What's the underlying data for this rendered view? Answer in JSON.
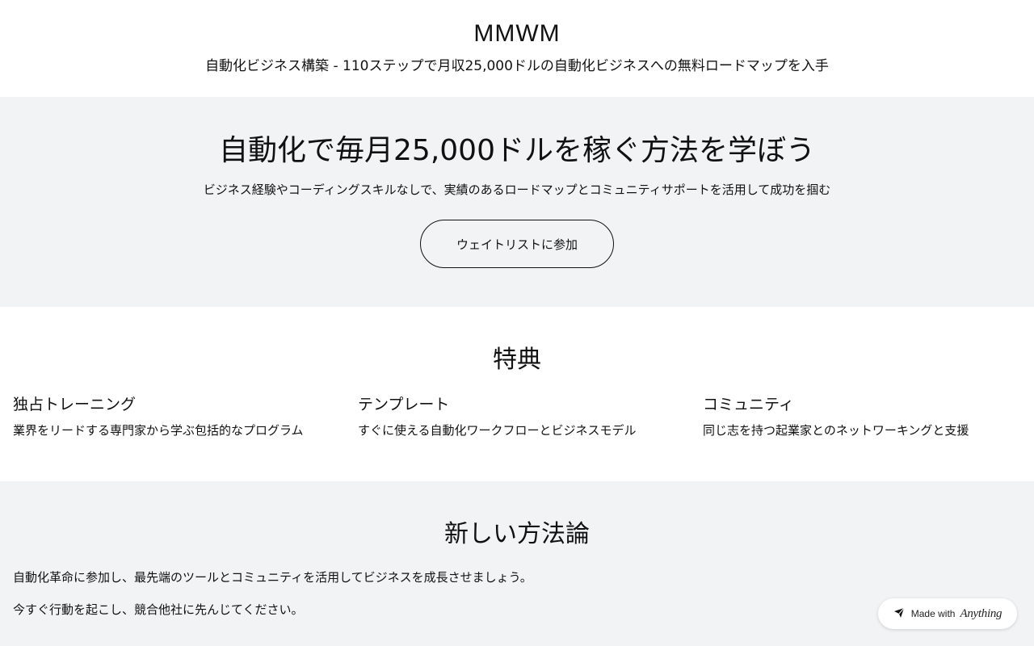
{
  "header": {
    "brand": "MMWM",
    "tagline": "自動化ビジネス構築 - 110ステップで月収25,000ドルの自動化ビジネスへの無料ロードマップを入手"
  },
  "hero": {
    "title": "自動化で毎月25,000ドルを稼ぐ方法を学ぼう",
    "subtitle": "ビジネス経験やコーディングスキルなしで、実績のあるロードマップとコミュニティサポートを活用して成功を掴む",
    "cta_label": "ウェイトリストに参加"
  },
  "benefits": {
    "title": "特典",
    "items": [
      {
        "name": "独占トレーニング",
        "desc": "業界をリードする専門家から学ぶ包括的なプログラム"
      },
      {
        "name": "テンプレート",
        "desc": "すぐに使える自動化ワークフローとビジネスモデル"
      },
      {
        "name": "コミュニティ",
        "desc": "同じ志を持つ起業家とのネットワーキングと支援"
      }
    ]
  },
  "methodology": {
    "title": "新しい方法論",
    "paragraphs": [
      "自動化革命に参加し、最先端のツールとコミュニティを活用してビジネスを成長させましょう。",
      "今すぐ行動を起こし、競合他社に先んじてください。"
    ]
  },
  "badge": {
    "label": "Made with",
    "brand": "Anything",
    "icon": "anything-logo-icon"
  }
}
